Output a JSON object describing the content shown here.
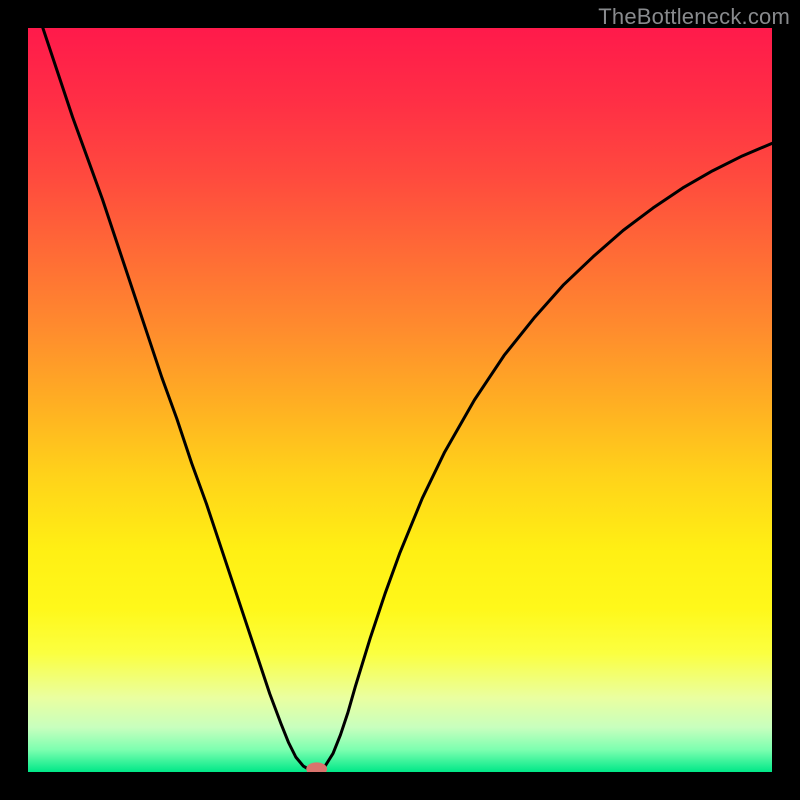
{
  "watermark": "TheBottleneck.com",
  "chart_data": {
    "type": "line",
    "title": "",
    "xlabel": "",
    "ylabel": "",
    "xlim": [
      0,
      100
    ],
    "ylim": [
      0,
      100
    ],
    "gradient_stops": [
      {
        "offset": 0.0,
        "color": "#ff1a4b"
      },
      {
        "offset": 0.1,
        "color": "#ff2f45"
      },
      {
        "offset": 0.2,
        "color": "#ff4a3e"
      },
      {
        "offset": 0.3,
        "color": "#ff6a36"
      },
      {
        "offset": 0.4,
        "color": "#ff8a2e"
      },
      {
        "offset": 0.5,
        "color": "#ffad23"
      },
      {
        "offset": 0.6,
        "color": "#ffd21a"
      },
      {
        "offset": 0.7,
        "color": "#ffef14"
      },
      {
        "offset": 0.78,
        "color": "#fff81a"
      },
      {
        "offset": 0.84,
        "color": "#fbff40"
      },
      {
        "offset": 0.9,
        "color": "#eaffa0"
      },
      {
        "offset": 0.94,
        "color": "#c8ffbe"
      },
      {
        "offset": 0.97,
        "color": "#7dffb0"
      },
      {
        "offset": 1.0,
        "color": "#00e888"
      }
    ],
    "series": [
      {
        "name": "bottleneck-curve",
        "color": "#000000",
        "width": 3,
        "points": [
          {
            "x": 2.0,
            "y": 100.0
          },
          {
            "x": 4.0,
            "y": 94.0
          },
          {
            "x": 6.0,
            "y": 88.0
          },
          {
            "x": 8.0,
            "y": 82.5
          },
          {
            "x": 10.0,
            "y": 77.0
          },
          {
            "x": 12.0,
            "y": 71.0
          },
          {
            "x": 14.0,
            "y": 65.0
          },
          {
            "x": 16.0,
            "y": 59.0
          },
          {
            "x": 18.0,
            "y": 53.0
          },
          {
            "x": 20.0,
            "y": 47.5
          },
          {
            "x": 22.0,
            "y": 41.5
          },
          {
            "x": 24.0,
            "y": 36.0
          },
          {
            "x": 26.0,
            "y": 30.0
          },
          {
            "x": 28.0,
            "y": 24.0
          },
          {
            "x": 29.5,
            "y": 19.5
          },
          {
            "x": 31.0,
            "y": 15.0
          },
          {
            "x": 32.5,
            "y": 10.5
          },
          {
            "x": 34.0,
            "y": 6.5
          },
          {
            "x": 35.0,
            "y": 4.0
          },
          {
            "x": 36.0,
            "y": 2.0
          },
          {
            "x": 37.0,
            "y": 0.8
          },
          {
            "x": 38.0,
            "y": 0.2
          },
          {
            "x": 38.6,
            "y": 0.1
          },
          {
            "x": 39.3,
            "y": 0.2
          },
          {
            "x": 40.0,
            "y": 0.9
          },
          {
            "x": 41.0,
            "y": 2.5
          },
          {
            "x": 42.0,
            "y": 5.0
          },
          {
            "x": 43.0,
            "y": 8.0
          },
          {
            "x": 44.0,
            "y": 11.5
          },
          {
            "x": 46.0,
            "y": 18.0
          },
          {
            "x": 48.0,
            "y": 24.0
          },
          {
            "x": 50.0,
            "y": 29.5
          },
          {
            "x": 53.0,
            "y": 36.8
          },
          {
            "x": 56.0,
            "y": 43.0
          },
          {
            "x": 60.0,
            "y": 50.0
          },
          {
            "x": 64.0,
            "y": 56.0
          },
          {
            "x": 68.0,
            "y": 61.0
          },
          {
            "x": 72.0,
            "y": 65.5
          },
          {
            "x": 76.0,
            "y": 69.3
          },
          {
            "x": 80.0,
            "y": 72.8
          },
          {
            "x": 84.0,
            "y": 75.8
          },
          {
            "x": 88.0,
            "y": 78.5
          },
          {
            "x": 92.0,
            "y": 80.8
          },
          {
            "x": 96.0,
            "y": 82.8
          },
          {
            "x": 100.0,
            "y": 84.5
          }
        ]
      }
    ],
    "marker": {
      "x": 38.8,
      "y": 0.4,
      "rx": 1.4,
      "ry": 0.9,
      "color": "#d9746d"
    }
  }
}
